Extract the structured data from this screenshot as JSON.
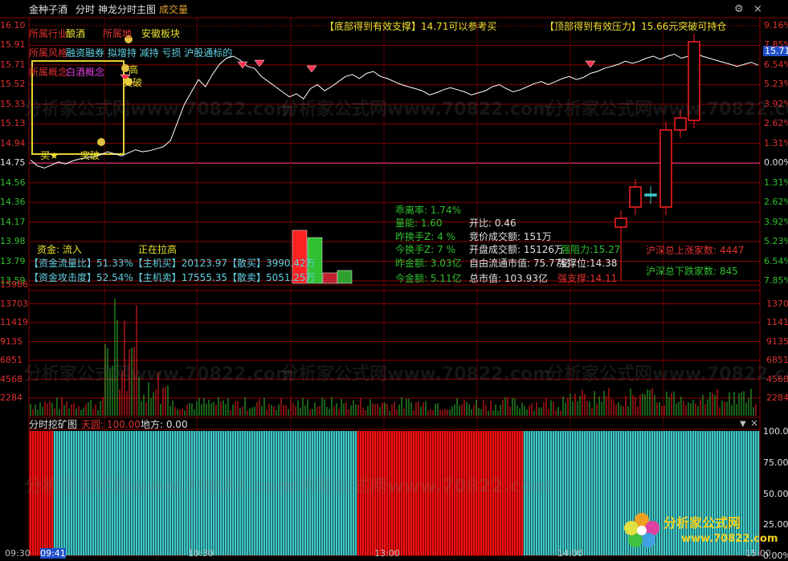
{
  "header": {
    "stock": "金种子酒",
    "mode": "分时",
    "chart_name": "神龙分时主图",
    "volume_label": "成交量",
    "window_icons": [
      "gear-icon",
      "close-icon"
    ]
  },
  "top_annotations": {
    "support": "【底部得到有效支撑】14.71可以参考买",
    "pressure": "【顶部得到有效压力】15.66元突破可持仓"
  },
  "left_axis": [
    "16.10",
    "15.91",
    "15.71",
    "15.52",
    "15.33",
    "15.13",
    "14.94",
    "14.75",
    "14.56",
    "14.36",
    "14.17",
    "13.98",
    "13.79",
    "13.59"
  ],
  "right_axis": [
    "9.16%",
    "7.85%",
    "6.54%",
    "5.23%",
    "3.92%",
    "2.62%",
    "1.31%",
    "0.00%",
    "1.31%",
    "2.62%",
    "3.92%",
    "5.23%",
    "6.54%",
    "7.85%"
  ],
  "current_price_tag": "15.71",
  "industry": {
    "row1_label": "所属行业",
    "row1_value": "酿酒",
    "row1_label2": "所属地",
    "row1_value2": "安徽板块",
    "row2_label": "所属风格",
    "row2_value": "融资融券 拟增持 减持 亏损 沪股通标的",
    "row3_label": "所属概念",
    "row3_value": "白酒概念"
  },
  "markers": {
    "buy": "买★",
    "breakout1": "突破",
    "high": "高",
    "breakout2": "突破"
  },
  "fund_flow": {
    "title": "资金: 流入",
    "status": "正在拉高",
    "row1": "【资金流量比】51.33%【主机买】20123.97【散买】3990.42万",
    "row2": "【资金攻击度】52.54%【主机卖】17555.35【散卖】5051.25万"
  },
  "stats": {
    "deviation": "乖离率: 1.74%",
    "volume_ratio": "量能: 1.60",
    "open_ratio": "开比: 0.46",
    "turnover_z": "昨换手Z: 4 %",
    "auction_amount": "竞价成交额: 151万",
    "today_turnover_z": "今换手Z: 7 %",
    "open_amount": "开盘成交额: 15126万",
    "resistance": "强阻力:15.27",
    "yesterday_amount": "昨金额: 3.03亿",
    "float_cap": "自由流通市值: 75.77亿",
    "pressure_level": "强撑位:14.38",
    "today_amount": "今金额: 5.11亿",
    "total_cap": "总市值: 103.93亿",
    "strong_support": "强支撑:14.11"
  },
  "market_breadth": {
    "up": "沪深总上涨家数: 4447",
    "down": "沪深总下跌家数: 845"
  },
  "volume_axis": [
    "15986",
    "13703",
    "11419",
    "9135",
    "6851",
    "4568",
    "2284"
  ],
  "volume_axis_right": [
    "13703",
    "11419",
    "9135",
    "6851",
    "4568",
    "2284"
  ],
  "indicator": {
    "name": "分时挖矿图",
    "sky_label": "天圆: 100.00",
    "earth_label": "地方: 0.00",
    "right_axis": [
      "100.00%",
      "75.00%",
      "50.00%",
      "25.00%",
      "0.00%"
    ]
  },
  "time_axis": [
    "09:30",
    "09:41",
    "10:30",
    "13:00",
    "14:00",
    "15:00"
  ],
  "watermark": {
    "site": "分析家公式网",
    "url": "www.70822.com"
  },
  "colors": {
    "up": "#ff2020",
    "down": "#30c030",
    "grid": "#8a0000",
    "price_line": "#ffffff",
    "cyan": "#40c8c8",
    "yellow": "#e8c040"
  }
}
